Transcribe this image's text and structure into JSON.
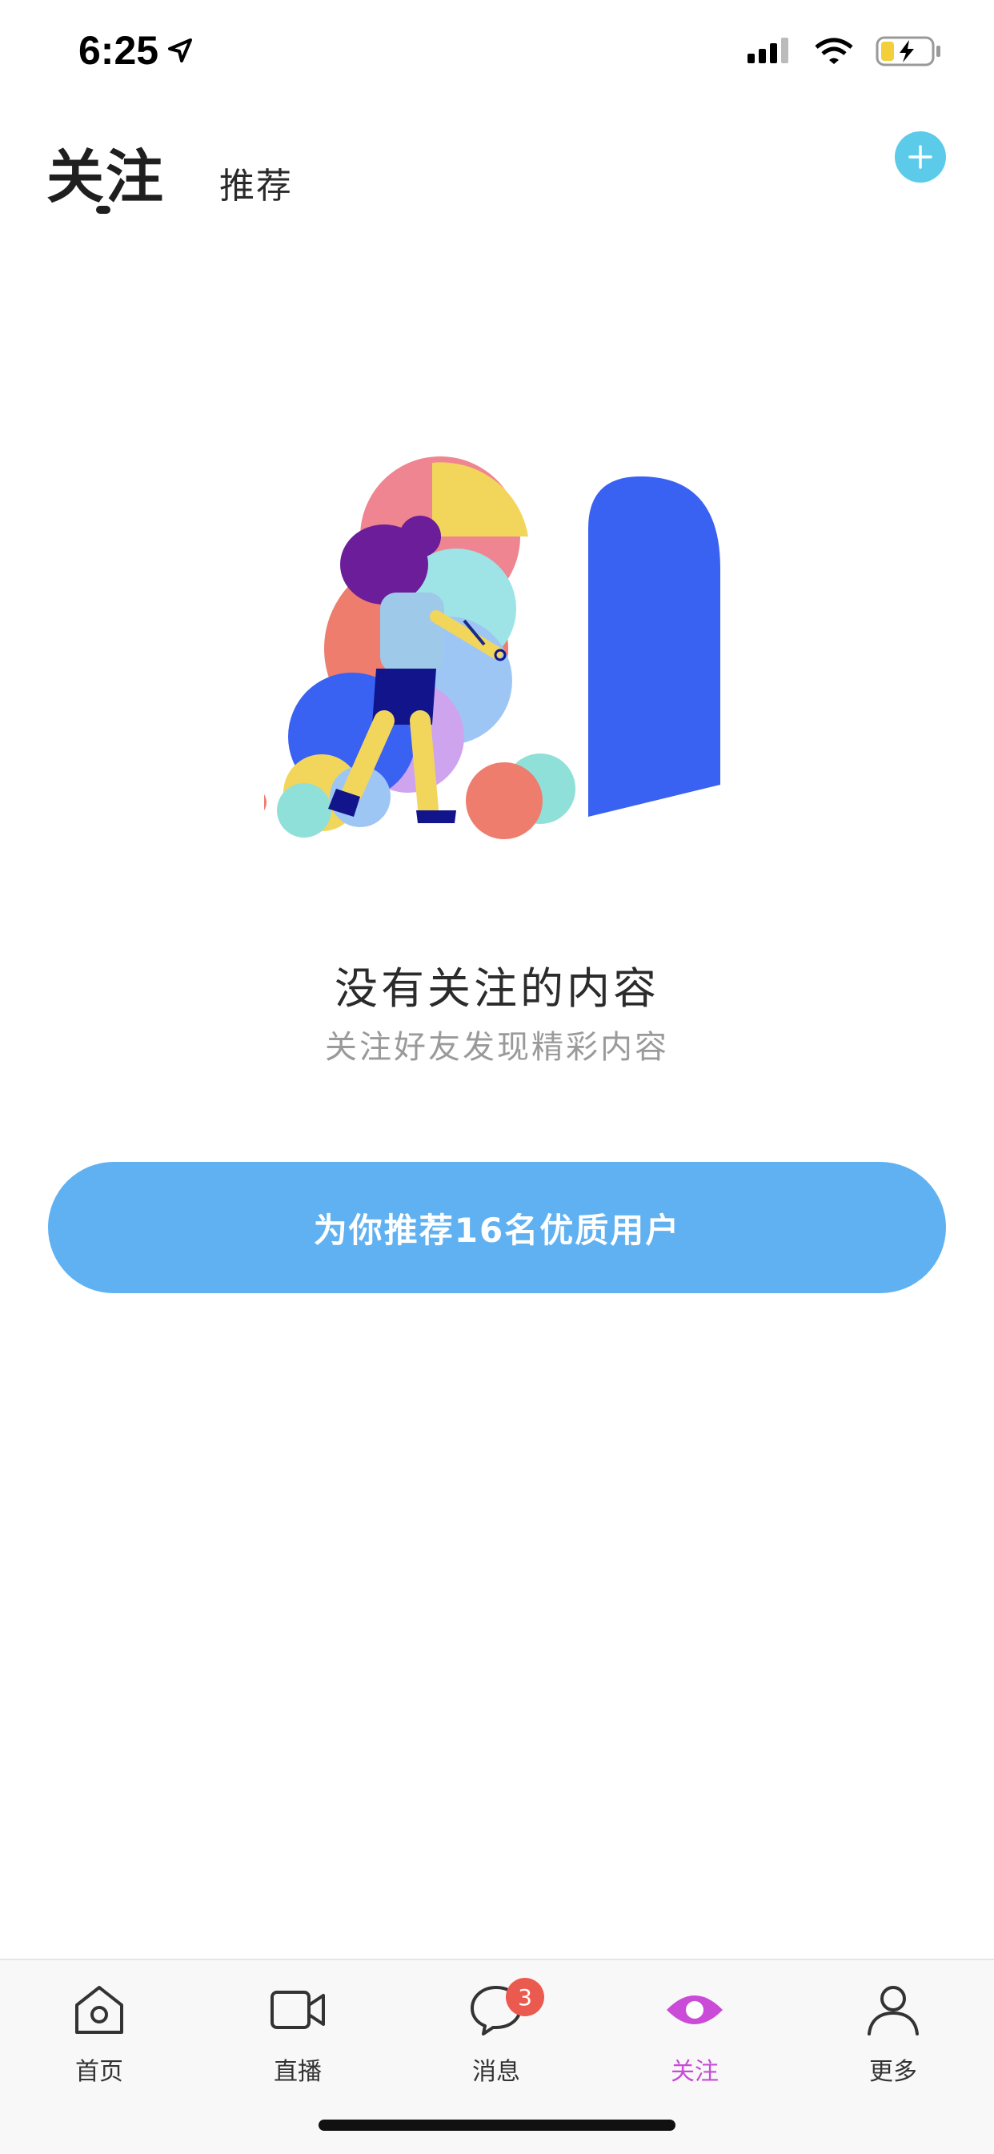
{
  "status_bar": {
    "time": "6:25"
  },
  "header": {
    "active_tab": "关注",
    "inactive_tab": "推荐"
  },
  "empty_state": {
    "title": "没有关注的内容",
    "subtitle": "关注好友发现精彩内容",
    "button_label": "为你推荐16名优质用户"
  },
  "tabbar": {
    "items": [
      {
        "label": "首页",
        "icon": "home-icon"
      },
      {
        "label": "直播",
        "icon": "video-icon"
      },
      {
        "label": "消息",
        "icon": "chat-icon",
        "badge": "3"
      },
      {
        "label": "关注",
        "icon": "eye-icon",
        "active": true
      },
      {
        "label": "更多",
        "icon": "profile-icon"
      }
    ]
  },
  "colors": {
    "accent_blue": "#5fb1f2",
    "add_button": "#5bcbe9",
    "active_tab": "#c94bd8",
    "badge": "#ea5a4f"
  }
}
